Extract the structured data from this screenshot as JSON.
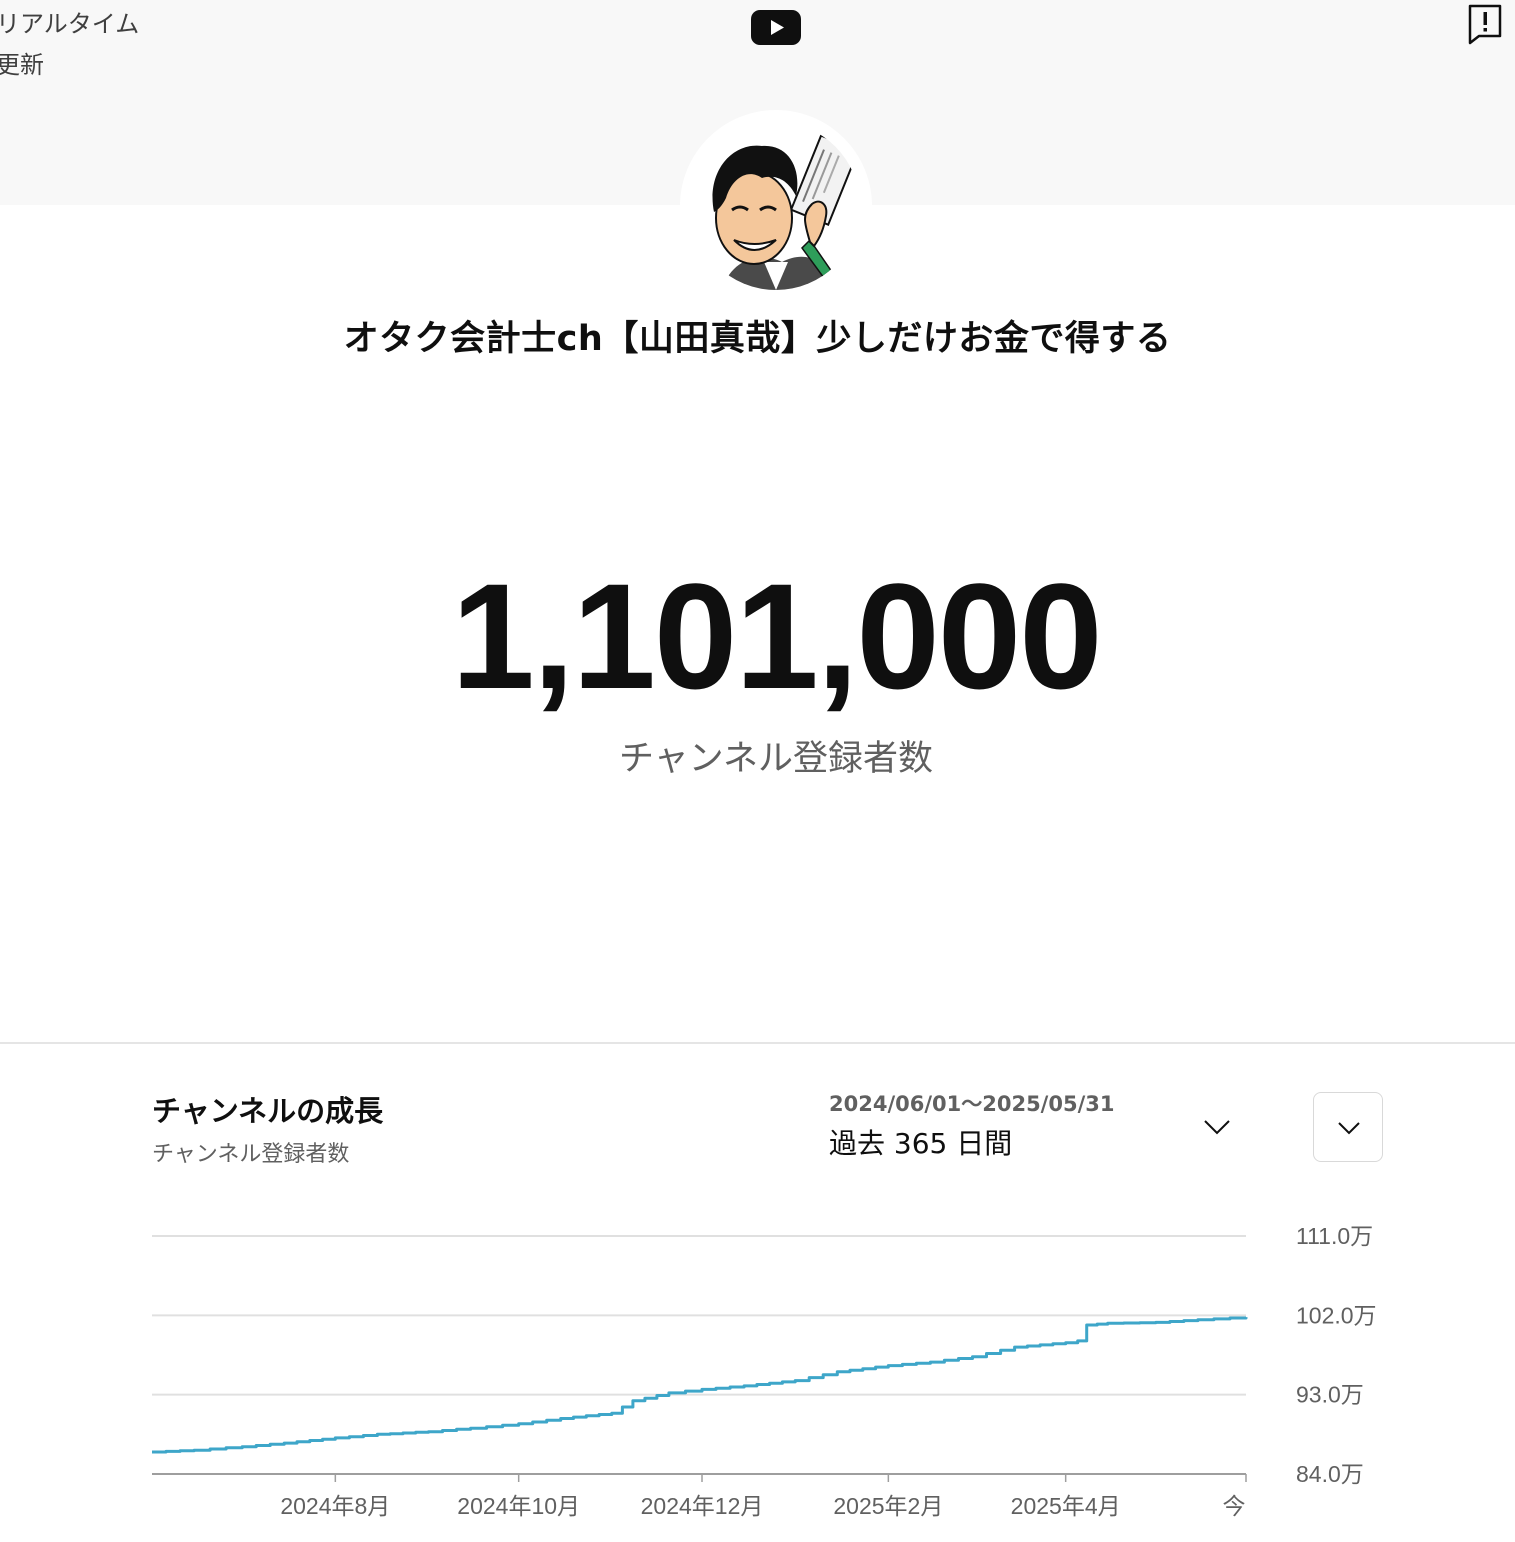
{
  "header": {
    "realtime_label": "リアルタイム更新",
    "youtube_icon": "youtube-play-icon",
    "report_icon": "report-flag-icon"
  },
  "channel": {
    "name": "オタク会計士ch【山田真哉】少しだけお金で得する",
    "avatar": "channel-avatar-caricature"
  },
  "subscribers": {
    "count": "1,101,000",
    "label": "チャンネル登録者数"
  },
  "growth": {
    "title": "チャンネルの成長",
    "subtitle": "チャンネル登録者数",
    "date_range": "2024/06/01～2025/05/31",
    "period": "過去 365 日間",
    "period_chevron_icon": "chevron-down-icon",
    "expand_icon": "chevron-down-icon"
  },
  "colors": {
    "line": "#3ea6c9",
    "grid": "#e0e0e0",
    "axis": "#9e9e9e",
    "youtube_logo": "#0f0f0f"
  },
  "chart_data": {
    "type": "line",
    "x_tick_labels": [
      "2024年8月",
      "2024年10月",
      "2024年12月",
      "2025年2月",
      "2025年4月",
      "今"
    ],
    "y_tick_labels": [
      "111.0万",
      "102.0万",
      "93.0万",
      "84.0万"
    ],
    "y_ticks": [
      1110000,
      1020000,
      930000,
      840000
    ],
    "ylim": [
      840000,
      1110000
    ],
    "xlim": [
      "2024-06-01",
      "2025-05-31"
    ],
    "grid": true,
    "series": [
      {
        "x": [
          "2024-06-01",
          "2024-06-15",
          "2024-07-01",
          "2024-07-15",
          "2024-08-01",
          "2024-08-15",
          "2024-09-01",
          "2024-09-15",
          "2024-10-01",
          "2024-10-15",
          "2024-11-01",
          "2024-11-08",
          "2024-11-20",
          "2024-12-01",
          "2024-12-15",
          "2025-01-01",
          "2025-01-15",
          "2025-02-01",
          "2025-02-15",
          "2025-03-01",
          "2025-03-15",
          "2025-04-01",
          "2025-04-05",
          "2025-04-08",
          "2025-04-15",
          "2025-05-01",
          "2025-05-15",
          "2025-05-31"
        ],
        "y": [
          865000,
          867000,
          871000,
          875000,
          881000,
          885000,
          888000,
          892000,
          897000,
          903000,
          909000,
          923000,
          932000,
          936000,
          940000,
          946000,
          956000,
          963000,
          967000,
          973000,
          984000,
          989000,
          991000,
          1009000,
          1011000,
          1012000,
          1015000,
          1018000
        ]
      }
    ]
  }
}
